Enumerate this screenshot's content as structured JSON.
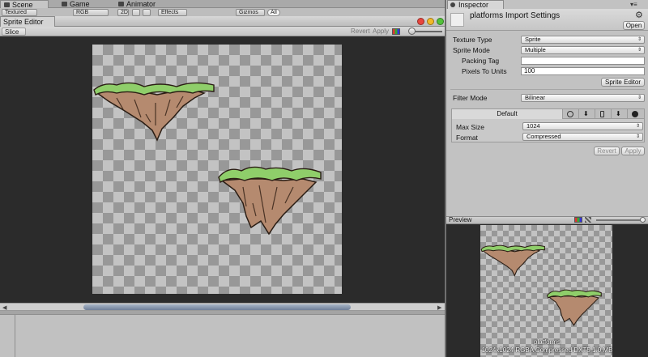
{
  "top_tabs": [
    {
      "label": "Scene",
      "active": true
    },
    {
      "label": "Game",
      "active": false
    },
    {
      "label": "Animator",
      "active": false
    }
  ],
  "scene_toolbar": {
    "shading": "Textured",
    "render": "RGB",
    "mode_2d": "2D",
    "effects": "Effects",
    "gizmos": "Gizmos",
    "search": "All"
  },
  "sprite_editor": {
    "window_title": "Sprite Editor",
    "slice_label": "Slice",
    "revert_label": "Revert",
    "apply_label": "Apply"
  },
  "inspector": {
    "tab_label": "Inspector",
    "title": "platforms Import Settings",
    "open_label": "Open",
    "fields": {
      "texture_type": {
        "label": "Texture Type",
        "value": "Sprite"
      },
      "sprite_mode": {
        "label": "Sprite Mode",
        "value": "Multiple"
      },
      "packing_tag": {
        "label": "Packing Tag",
        "value": ""
      },
      "pixels_to_units": {
        "label": "Pixels To Units",
        "value": "100"
      },
      "filter_mode": {
        "label": "Filter Mode",
        "value": "Bilinear"
      }
    },
    "sprite_editor_button": "Sprite Editor",
    "platform": {
      "default_tab": "Default",
      "max_size": {
        "label": "Max Size",
        "value": "1024"
      },
      "format": {
        "label": "Format",
        "value": "Compressed"
      }
    },
    "revert_label": "Revert",
    "apply_label": "Apply"
  },
  "preview": {
    "title": "Preview",
    "caption_name": "platforms",
    "caption_info": "1024x1024  RGBA Compressed DXT5    1.0 MB"
  },
  "colors": {
    "canvas_bg": "#2b2b2b",
    "grass": "#8fce6a",
    "rock": "#b58a6f",
    "outline": "#2a1d14"
  }
}
